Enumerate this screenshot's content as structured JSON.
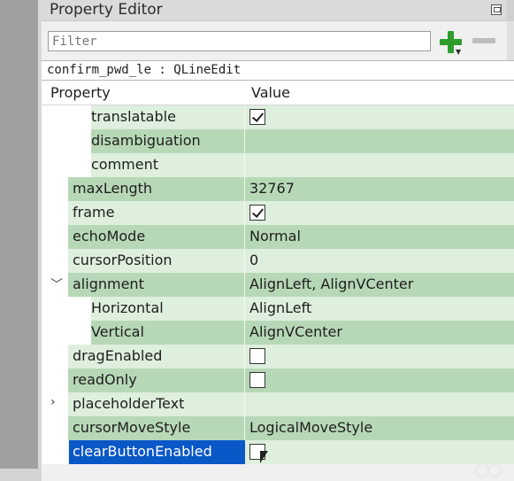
{
  "panel": {
    "title": "Property Editor"
  },
  "filter": {
    "placeholder": "Filter",
    "add_icon": "plus-icon",
    "remove_icon": "minus-icon"
  },
  "object_line": "confirm_pwd_le : QLineEdit",
  "table": {
    "header_property": "Property",
    "header_value": "Value"
  },
  "rows": [
    {
      "name": "translatable",
      "value_type": "checkbox",
      "checked": true
    },
    {
      "name": "disambiguation",
      "value": ""
    },
    {
      "name": "comment",
      "value": ""
    },
    {
      "name": "maxLength",
      "value": "32767"
    },
    {
      "name": "frame",
      "value_type": "checkbox",
      "checked": true
    },
    {
      "name": "echoMode",
      "value": "Normal"
    },
    {
      "name": "cursorPosition",
      "value": "0"
    },
    {
      "name": "alignment",
      "value": "AlignLeft, AlignVCenter",
      "expanded": true
    },
    {
      "name": "Horizontal",
      "value": "AlignLeft"
    },
    {
      "name": "Vertical",
      "value": "AlignVCenter"
    },
    {
      "name": "dragEnabled",
      "value_type": "checkbox",
      "checked": false
    },
    {
      "name": "readOnly",
      "value_type": "checkbox",
      "checked": false
    },
    {
      "name": "placeholderText",
      "value": "",
      "expanded": false
    },
    {
      "name": "cursorMoveStyle",
      "value": "LogicalMoveStyle"
    },
    {
      "name": "clearButtonEnabled",
      "value_type": "checkbox",
      "checked": false,
      "selected": true
    }
  ],
  "colors": {
    "row_light": "#deefde",
    "row_dark": "#b7d8b7",
    "selection": "#0a57c8",
    "add_icon": "#2e9d2e"
  }
}
